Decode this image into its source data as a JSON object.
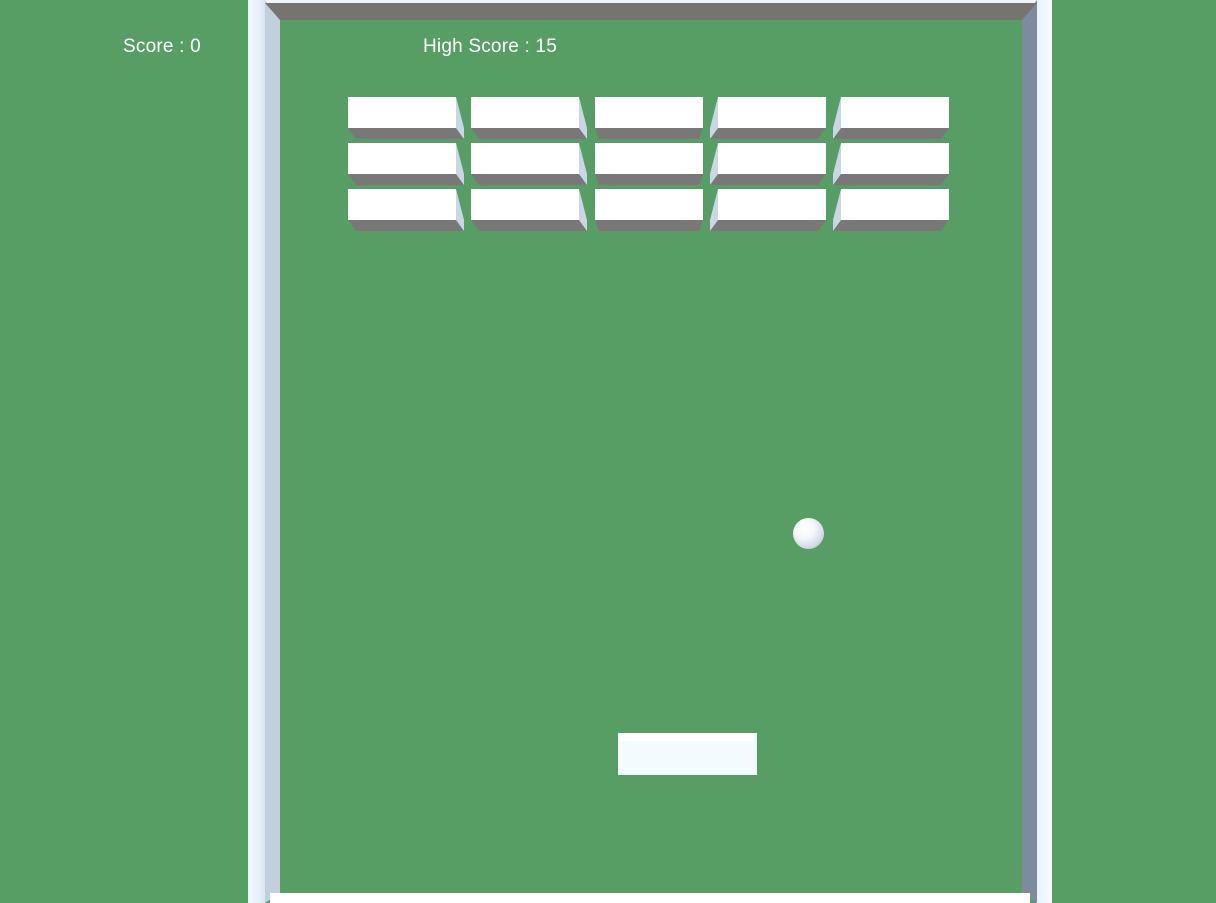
{
  "hud": {
    "score_label": "Score : 0",
    "high_score_label": "High Score : 15"
  },
  "game": {
    "score": 0,
    "high_score": 15,
    "brick_rows": 3,
    "brick_columns": 5,
    "bricks_remaining": 15
  },
  "colors": {
    "background": "#579e64",
    "brick": "#ffffff",
    "brick_shadow": "#7a7877",
    "wall": "#eef5fc",
    "hud_text": "#ffffff"
  }
}
